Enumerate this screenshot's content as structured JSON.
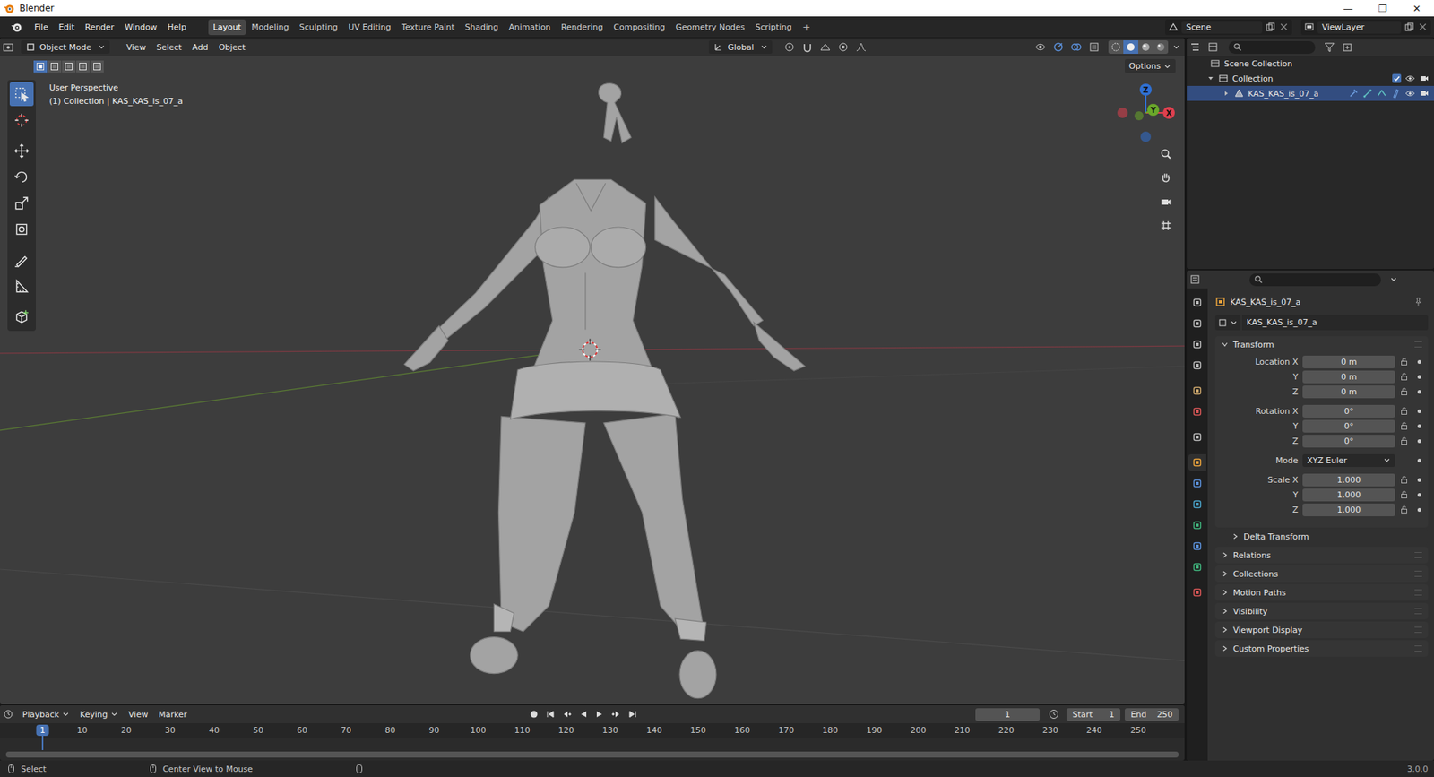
{
  "window": {
    "title": "Blender",
    "controls": [
      "—",
      "❐",
      "✕"
    ]
  },
  "menus": [
    "File",
    "Edit",
    "Render",
    "Window",
    "Help"
  ],
  "workspaces": [
    {
      "label": "Layout",
      "selected": true
    },
    {
      "label": "Modeling",
      "selected": false
    },
    {
      "label": "Sculpting",
      "selected": false
    },
    {
      "label": "UV Editing",
      "selected": false
    },
    {
      "label": "Texture Paint",
      "selected": false
    },
    {
      "label": "Shading",
      "selected": false
    },
    {
      "label": "Animation",
      "selected": false
    },
    {
      "label": "Rendering",
      "selected": false
    },
    {
      "label": "Compositing",
      "selected": false
    },
    {
      "label": "Geometry Nodes",
      "selected": false
    },
    {
      "label": "Scripting",
      "selected": false
    }
  ],
  "add_workspace": "+",
  "scene": "Scene",
  "view_layer": "ViewLayer",
  "viewport": {
    "mode": "Object Mode",
    "menus": [
      "View",
      "Select",
      "Add",
      "Object"
    ],
    "orientation": "Global",
    "options": "Options",
    "overlay": [
      "User Perspective",
      "(1) Collection | KAS_KAS_is_07_a"
    ],
    "axes": [
      {
        "label": "Z",
        "color": "#2f6fd1"
      },
      {
        "label": "X",
        "color": "#e0404f"
      },
      {
        "label": "Y",
        "color": "#6aa82a"
      }
    ],
    "select_modes": [
      {
        "selected": true
      },
      {
        "selected": false
      },
      {
        "selected": false
      },
      {
        "selected": false
      },
      {
        "selected": false
      }
    ],
    "shading": [
      {
        "kind": "wireframe",
        "selected": false
      },
      {
        "kind": "solid",
        "selected": true
      },
      {
        "kind": "material",
        "selected": false
      },
      {
        "kind": "rendered",
        "selected": false
      }
    ],
    "tools": [
      {
        "kind": "select",
        "selected": true
      },
      {
        "kind": "cursor",
        "selected": false
      },
      {
        "kind": "move",
        "selected": false
      },
      {
        "kind": "rotate",
        "selected": false
      },
      {
        "kind": "scale",
        "selected": false
      },
      {
        "kind": "transform",
        "selected": false
      },
      {
        "kind": "annotate",
        "selected": false
      },
      {
        "kind": "measure",
        "selected": false
      },
      {
        "kind": "add-cube",
        "selected": false
      }
    ]
  },
  "outliner": {
    "root": {
      "label": "Scene Collection",
      "children": [
        {
          "label": "Collection",
          "expanded": true,
          "checked": true,
          "selected": false,
          "children": [
            {
              "label": "KAS_KAS_is_07_a",
              "expanded": false,
              "selected": true
            }
          ]
        }
      ]
    }
  },
  "properties": {
    "tabs": [
      {
        "selected": false,
        "color": "#b8b8b8"
      },
      {
        "selected": false,
        "color": "#b8b8b8"
      },
      {
        "selected": false,
        "color": "#b8b8b8"
      },
      {
        "selected": false,
        "color": "#b8b8b8"
      },
      {
        "selected": false,
        "color": "#c9a46a"
      },
      {
        "selected": false,
        "color": "#d45555"
      },
      {
        "selected": false,
        "color": "#b8b8b8"
      },
      {
        "selected": true,
        "color": "#e9a23b"
      },
      {
        "selected": false,
        "color": "#5a8fd8"
      },
      {
        "selected": false,
        "color": "#4aa3c9"
      },
      {
        "selected": false,
        "color": "#3fb07a"
      },
      {
        "selected": false,
        "color": "#5a8fd8"
      },
      {
        "selected": false,
        "color": "#3fb07a"
      },
      {
        "selected": false,
        "color": "#d45555"
      }
    ],
    "object": "KAS_KAS_is_07_a",
    "name": "KAS_KAS_is_07_a",
    "transform": {
      "title": "Transform",
      "expanded": true,
      "groups": [
        [
          {
            "label": "Location X",
            "value": "0 m",
            "kind": "number"
          },
          {
            "label": "Y",
            "value": "0 m",
            "kind": "number"
          },
          {
            "label": "Z",
            "value": "0 m",
            "kind": "number"
          }
        ],
        [
          {
            "label": "Rotation X",
            "value": "0°",
            "kind": "number"
          },
          {
            "label": "Y",
            "value": "0°",
            "kind": "number"
          },
          {
            "label": "Z",
            "value": "0°",
            "kind": "number"
          }
        ],
        [
          {
            "label": "Mode",
            "value": "XYZ Euler",
            "kind": "dropdown"
          }
        ],
        [
          {
            "label": "Scale X",
            "value": "1.000",
            "kind": "number"
          },
          {
            "label": "Y",
            "value": "1.000",
            "kind": "number"
          },
          {
            "label": "Z",
            "value": "1.000",
            "kind": "number"
          }
        ]
      ]
    },
    "panels": [
      {
        "label": "Delta Transform",
        "kind": "subpanel",
        "expanded": false
      },
      {
        "label": "Relations",
        "kind": "panel",
        "expanded": false
      },
      {
        "label": "Collections",
        "kind": "panel",
        "expanded": false
      },
      {
        "label": "Motion Paths",
        "kind": "panel",
        "expanded": false
      },
      {
        "label": "Visibility",
        "kind": "panel",
        "expanded": false
      },
      {
        "label": "Viewport Display",
        "kind": "panel",
        "expanded": false
      },
      {
        "label": "Custom Properties",
        "kind": "panel",
        "expanded": false
      }
    ]
  },
  "timeline": {
    "menus": [
      {
        "label": "Playback",
        "dropdown": true
      },
      {
        "label": "Keying",
        "dropdown": true
      },
      {
        "label": "View",
        "dropdown": false
      },
      {
        "label": "Marker",
        "dropdown": false
      }
    ],
    "frame": "1",
    "start_label": "Start",
    "start": "1",
    "end_label": "End",
    "end": "250",
    "current": "1",
    "ticks": [
      "10",
      "20",
      "30",
      "40",
      "50",
      "60",
      "70",
      "80",
      "90",
      "100",
      "110",
      "120",
      "130",
      "140",
      "150",
      "160",
      "170",
      "180",
      "190",
      "200",
      "210",
      "220",
      "230",
      "240",
      "250"
    ]
  },
  "status": {
    "items": [
      "Select",
      "Center View to Mouse"
    ],
    "version": "3.0.0"
  }
}
